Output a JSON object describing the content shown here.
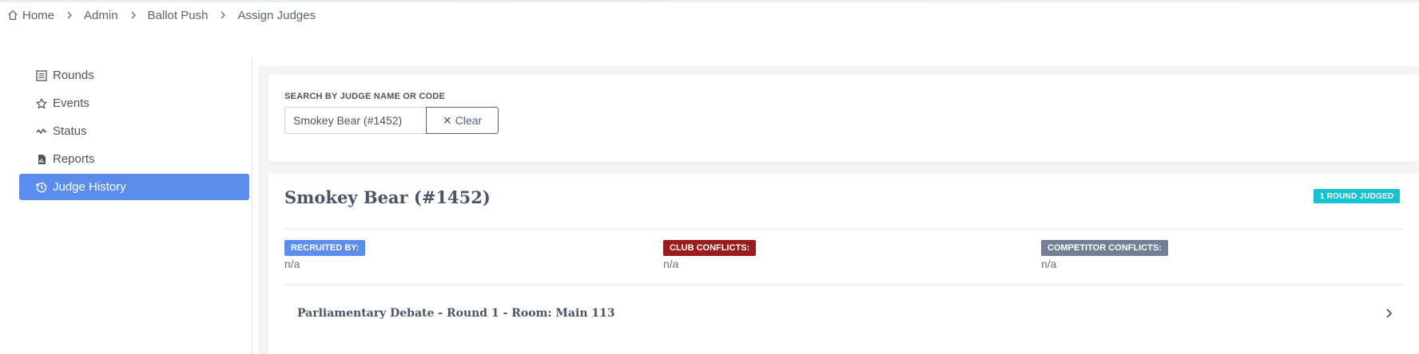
{
  "breadcrumb": {
    "items": [
      "Home",
      "Admin",
      "Ballot Push",
      "Assign Judges"
    ]
  },
  "sidebar": {
    "items": [
      {
        "label": "Rounds",
        "icon": "list-icon",
        "active": false
      },
      {
        "label": "Events",
        "icon": "star-icon",
        "active": false
      },
      {
        "label": "Status",
        "icon": "pulse-icon",
        "active": false
      },
      {
        "label": "Reports",
        "icon": "report-icon",
        "active": false
      },
      {
        "label": "Judge History",
        "icon": "history-icon",
        "active": true
      }
    ]
  },
  "search": {
    "label": "SEARCH BY JUDGE NAME OR CODE",
    "value": "Smokey Bear (#1452)",
    "clear_label": "Clear"
  },
  "judge": {
    "name": "Smokey Bear (#1452)",
    "rounds_badge": "1 ROUND JUDGED",
    "recruited_label": "RECRUITED BY:",
    "recruited_value": "n/a",
    "club_conflicts_label": "CLUB CONFLICTS:",
    "club_conflicts_value": "n/a",
    "competitor_conflicts_label": "COMPETITOR CONFLICTS:",
    "competitor_conflicts_value": "n/a",
    "rounds": [
      "Parliamentary Debate - Round 1 - Room: Main 113"
    ]
  },
  "colors": {
    "active_nav": "#5b8def",
    "recruited_badge": "#5b8def",
    "club_badge": "#9b1c1c",
    "competitor_badge": "#718096",
    "rounds_badge": "#17c2d3"
  }
}
